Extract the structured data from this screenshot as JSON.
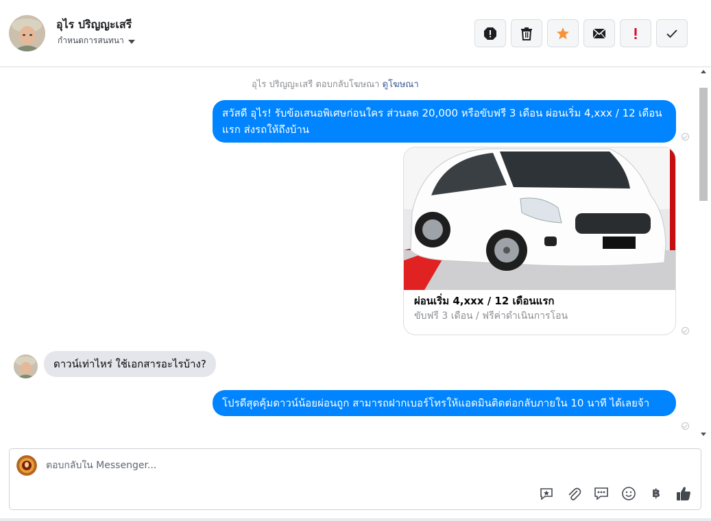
{
  "header": {
    "contact_name": "อุไร ปริญญะเสรี",
    "assign_label": "กำหนดการสนทนา",
    "toolbar": [
      {
        "name": "spam-icon"
      },
      {
        "name": "trash-icon"
      },
      {
        "name": "star-icon"
      },
      {
        "name": "mark-unread-icon"
      },
      {
        "name": "important-icon"
      },
      {
        "name": "done-check-icon"
      }
    ]
  },
  "chat": {
    "notice_text": "อุไร ปริญญะเสรี ตอบกลับโฆษณา",
    "notice_link": "ดูโฆษณา",
    "messages": [
      {
        "direction": "out",
        "text": "สวัสดี อุไร! รับข้อเสนอพิเศษก่อนใคร ส่วนลด 20,000 หรือขับฟรี 3 เดือน ผ่อนเริ่ม 4,xxx / 12 เดือนแรก ส่งรถให้ถึงบ้าน"
      },
      {
        "direction": "out",
        "type": "card",
        "title": "ผ่อนเริ่ม 4,xxx / 12 เดือนแรก",
        "subtitle": "ขับฟรี 3 เดือน / ฟรีค่าดำเนินการโอน"
      },
      {
        "direction": "in",
        "text": "ดาวน์เท่าไหร่ ใช้เอกสารอะไรบ้าง?"
      },
      {
        "direction": "out",
        "text": "โปรดีสุดคุ้มดาวน์น้อยผ่อนถูก สามารถฝากเบอร์โทรให้แอดมินติดต่อกลับภายใน 10 นาที ได้เลยจ้า"
      }
    ]
  },
  "composer": {
    "placeholder": "ตอบกลับใน Messenger...",
    "tools": [
      "saved-reply-icon",
      "attachment-icon",
      "quick-reply-icon",
      "emoji-icon",
      "baht-icon",
      "thumbs-up-icon"
    ],
    "baht_glyph": "฿"
  },
  "colors": {
    "outgoing_bubble": "#0084ff",
    "incoming_bubble": "#e4e6eb",
    "star_accent": "#f7923a",
    "important_red": "#e4002b"
  }
}
